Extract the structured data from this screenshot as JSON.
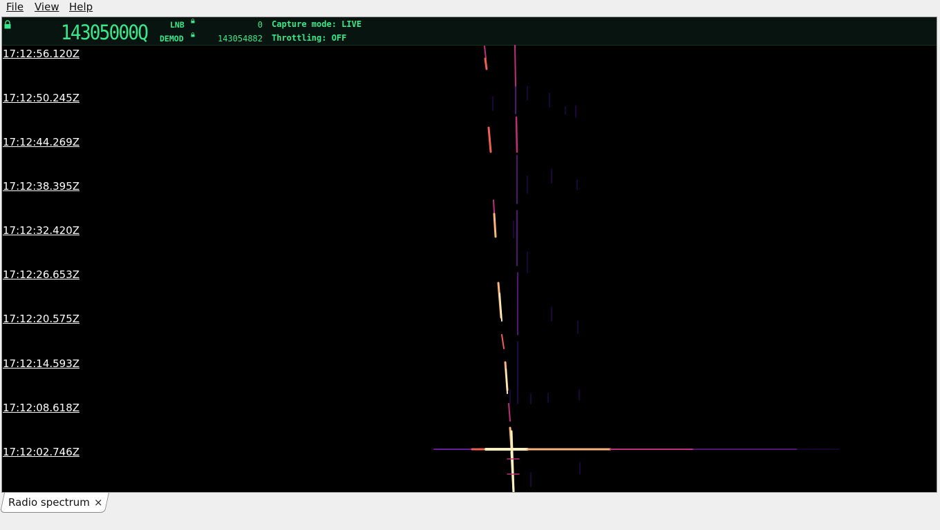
{
  "menu": [
    {
      "label": "File"
    },
    {
      "label": "View"
    },
    {
      "label": "Help"
    }
  ],
  "header": {
    "frequency_display": "14305000Q",
    "lnb_label": "LNB",
    "lnb_value": "0",
    "demod_label": "DEMOD",
    "demod_value": "143054882",
    "capture_mode": "Capture mode: LIVE",
    "throttling": "Throttling: OFF"
  },
  "waterfall": {
    "timestamps": [
      "17:12:56.120Z",
      "17:12:50.245Z",
      "17:12:44.269Z",
      "17:12:38.395Z",
      "17:12:32.420Z",
      "17:12:26.653Z",
      "17:12:20.575Z",
      "17:12:14.593Z",
      "17:12:08.618Z",
      "17:12:02.746Z"
    ],
    "palette": [
      "#000000",
      "#2a0a55",
      "#6a1d9a",
      "#c0307a",
      "#f06050",
      "#fbb57a",
      "#fff0c0"
    ]
  },
  "tabs": [
    {
      "label": "Radio spectrum",
      "close": "×"
    }
  ],
  "colors": {
    "accent_green": "#38e88c",
    "header_bg": "#07140f",
    "spectrum_bg": "#000000"
  }
}
